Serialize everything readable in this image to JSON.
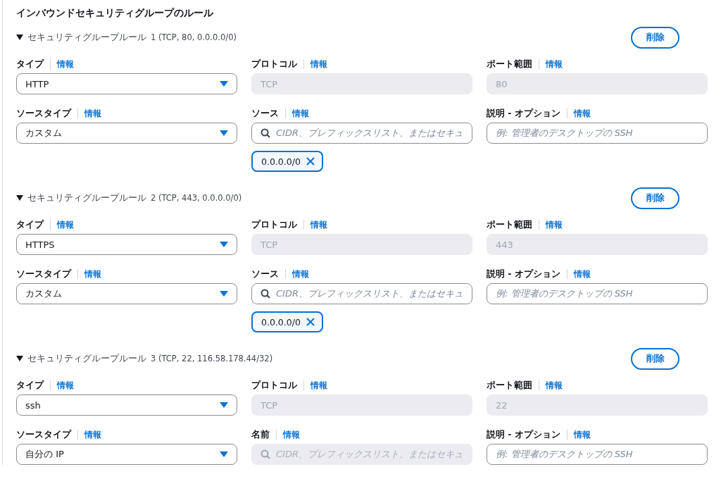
{
  "title": "インバウンドセキュリティグループのルール",
  "rules": [
    {
      "expanded": true,
      "title": "セキュリティグループルール",
      "summary": "1 (TCP, 80, 0.0.0.0/0)",
      "delete_button": "削除",
      "fields": [
        {
          "kind": "select",
          "label": "タイプ",
          "info": "情報",
          "value": "HTTP",
          "disabled": false
        },
        {
          "kind": "input",
          "label": "プロトコル",
          "info": "情報",
          "value": "TCP",
          "disabled": true
        },
        {
          "kind": "input",
          "label": "ポート範囲",
          "info": "情報",
          "value": "80",
          "disabled": true
        },
        {
          "kind": "select",
          "label": "ソースタイプ",
          "info": "情報",
          "value": "カスタム",
          "disabled": false
        },
        {
          "kind": "search",
          "label": "ソース",
          "info": "情報",
          "placeholder": "CIDR、プレフィックスリスト、またはセキュ",
          "disabled": false,
          "tokens": [
            "0.0.0.0/0"
          ]
        },
        {
          "kind": "input",
          "label": "説明 - オプション",
          "info": "情報",
          "placeholder": "例: 管理者のデスクトップの SSH",
          "disabled": false
        }
      ]
    },
    {
      "expanded": true,
      "title": "セキュリティグループルール",
      "summary": "2 (TCP, 443, 0.0.0.0/0)",
      "delete_button": "削除",
      "fields": [
        {
          "kind": "select",
          "label": "タイプ",
          "info": "情報",
          "value": "HTTPS",
          "disabled": false
        },
        {
          "kind": "input",
          "label": "プロトコル",
          "info": "情報",
          "value": "TCP",
          "disabled": true
        },
        {
          "kind": "input",
          "label": "ポート範囲",
          "info": "情報",
          "value": "443",
          "disabled": true
        },
        {
          "kind": "select",
          "label": "ソースタイプ",
          "info": "情報",
          "value": "カスタム",
          "disabled": false
        },
        {
          "kind": "search",
          "label": "ソース",
          "info": "情報",
          "placeholder": "CIDR、プレフィックスリスト、またはセキュ",
          "disabled": false,
          "tokens": [
            "0.0.0.0/0"
          ]
        },
        {
          "kind": "input",
          "label": "説明 - オプション",
          "info": "情報",
          "placeholder": "例: 管理者のデスクトップの SSH",
          "disabled": false
        }
      ]
    },
    {
      "expanded": true,
      "title": "セキュリティグループルール",
      "summary": "3 (TCP, 22, 116.58.178.44/32)",
      "delete_button": "削除",
      "fields": [
        {
          "kind": "select",
          "label": "タイプ",
          "info": "情報",
          "value": "ssh",
          "disabled": false
        },
        {
          "kind": "input",
          "label": "プロトコル",
          "info": "情報",
          "value": "TCP",
          "disabled": true
        },
        {
          "kind": "input",
          "label": "ポート範囲",
          "info": "情報",
          "value": "22",
          "disabled": true
        },
        {
          "kind": "select",
          "label": "ソースタイプ",
          "info": "情報",
          "value": "自分の IP",
          "disabled": false
        },
        {
          "kind": "search",
          "label": "名前",
          "info": "情報",
          "placeholder": "CIDR、プレフィックスリスト、またはセキュ",
          "disabled": true
        },
        {
          "kind": "input",
          "label": "説明 - オプション",
          "info": "情報",
          "placeholder": "例: 管理者のデスクトップの SSH",
          "disabled": false
        }
      ]
    }
  ]
}
